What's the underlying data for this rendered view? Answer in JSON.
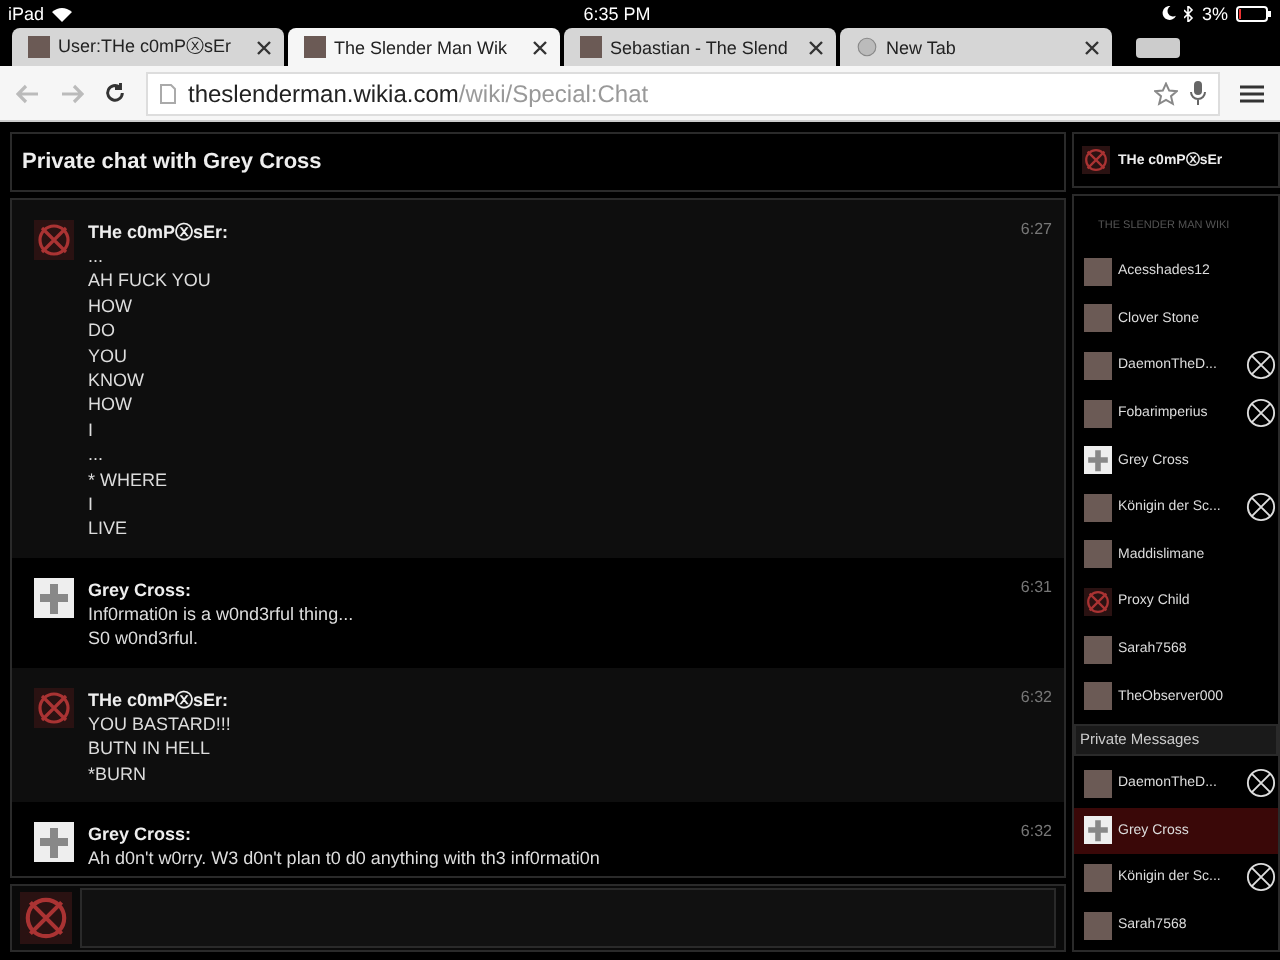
{
  "status_bar": {
    "device": "iPad",
    "time": "6:35 PM",
    "battery": "3%"
  },
  "tabs": [
    {
      "label": "User:THe c0mPⓧsEr",
      "selected": false,
      "kind": "photo"
    },
    {
      "label": "The Slender Man Wik",
      "selected": true,
      "kind": "photo"
    },
    {
      "label": "Sebastian - The Slend",
      "selected": false,
      "kind": "photo"
    },
    {
      "label": "New Tab",
      "selected": false,
      "kind": "globe"
    }
  ],
  "address_bar": {
    "host": "theslenderman.wikia.com",
    "path": "/wiki/Special:Chat"
  },
  "chat": {
    "title": "Private chat with Grey Cross",
    "messages": [
      {
        "user": "THe c0mPⓧsEr:",
        "kind": "x-circle",
        "time": "6:27",
        "lines": [
          "...",
          "AH FUCK YOU",
          "HOW",
          "DO",
          "YOU",
          "KNOW",
          "HOW",
          "I",
          "...",
          "* WHERE",
          "I",
          "LIVE"
        ]
      },
      {
        "user": "Grey Cross:",
        "kind": "cross",
        "time": "6:31",
        "lines": [
          "Inf0rmati0n is a w0nd3rful thing...",
          "S0 w0nd3rful."
        ]
      },
      {
        "user": "THe c0mPⓧsEr:",
        "kind": "x-circle",
        "time": "6:32",
        "lines": [
          "YOU BASTARD!!!",
          "BUTN IN HELL",
          "*BURN"
        ]
      },
      {
        "user": "Grey Cross:",
        "kind": "cross",
        "time": "6:32",
        "lines": [
          "Ah d0n't w0rry. W3 d0n't plan t0 d0 anything with th3 inf0rmati0n"
        ]
      }
    ]
  },
  "rail": {
    "me": {
      "name": "THe c0mPⓧsEr"
    },
    "wiki_label": "THE SLENDER MAN WIKI",
    "users": [
      {
        "name": "Acesshades12",
        "kind": "photo",
        "marked": false
      },
      {
        "name": "Clover Stone",
        "kind": "photo",
        "marked": false
      },
      {
        "name": "DaemonTheD...",
        "kind": "photo",
        "marked": true
      },
      {
        "name": "Fobarimperius",
        "kind": "photo",
        "marked": true
      },
      {
        "name": "Grey Cross",
        "kind": "cross",
        "marked": false
      },
      {
        "name": "Königin der Sc...",
        "kind": "photo",
        "marked": true
      },
      {
        "name": "Maddislimane",
        "kind": "photo",
        "marked": false
      },
      {
        "name": "Proxy Child",
        "kind": "x-circle",
        "marked": false
      },
      {
        "name": "Sarah7568",
        "kind": "photo",
        "marked": false
      },
      {
        "name": "TheObserver000",
        "kind": "photo",
        "marked": false
      }
    ],
    "private_label": "Private Messages",
    "private": [
      {
        "name": "DaemonTheD...",
        "kind": "photo",
        "marked": true,
        "selected": false
      },
      {
        "name": "Grey Cross",
        "kind": "cross",
        "marked": false,
        "selected": true
      },
      {
        "name": "Königin der Sc...",
        "kind": "photo",
        "marked": true,
        "selected": false
      },
      {
        "name": "Sarah7568",
        "kind": "photo",
        "marked": false,
        "selected": false
      }
    ]
  }
}
